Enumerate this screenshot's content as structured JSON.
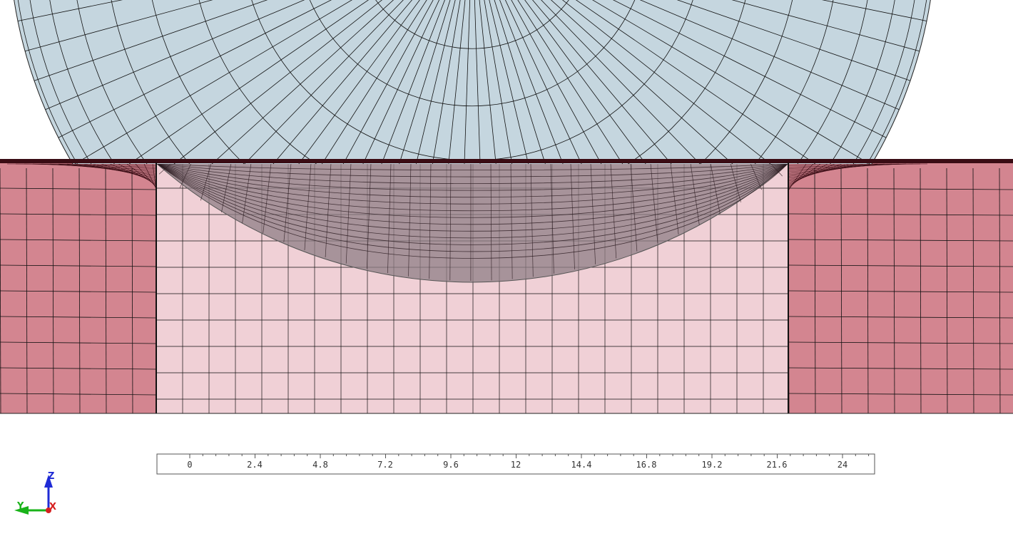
{
  "colors": {
    "background": "#ffffff",
    "impactor_fill": "#c5d6df",
    "mesh_line": "#111111",
    "target_outer": "#d38590",
    "target_inner": "#f0d0d6",
    "crater_fill": "#8f7f86",
    "contact_line": "#3a0c14",
    "scale_bar": "#555555",
    "triad_z": "#1f2bd6",
    "triad_y": "#19b319",
    "triad_x": "#d62020"
  },
  "scale_bar": {
    "labels": [
      "0",
      "2.4",
      "4.8",
      "7.2",
      "9.6",
      "12",
      "14.4",
      "16.8",
      "19.2",
      "21.6",
      "24"
    ]
  },
  "axis_triad": {
    "z_label": "Z",
    "y_label": "Y",
    "x_label": "X",
    "icons": [
      "z-arrow-icon",
      "y-arrow-icon",
      "x-arrow-icon"
    ]
  }
}
